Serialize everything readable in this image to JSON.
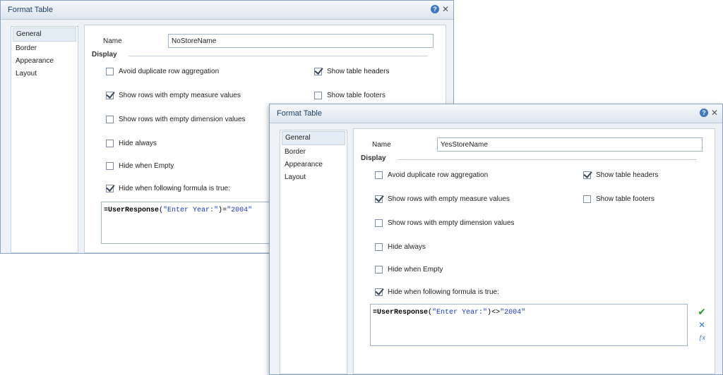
{
  "dialog1": {
    "title": "Format Table",
    "nav": [
      "General",
      "Border",
      "Appearance",
      "Layout"
    ],
    "name_label": "Name",
    "name_value": "NoStoreName",
    "display_label": "Display",
    "options_left": [
      {
        "label": "Avoid duplicate row aggregation",
        "checked": false
      },
      {
        "label": "Show rows with empty measure values",
        "checked": true
      },
      {
        "label": "Show rows with empty dimension values",
        "checked": false
      },
      {
        "label": "Hide always",
        "checked": false
      },
      {
        "label": "Hide when Empty",
        "checked": false
      },
      {
        "label": "Hide when following formula is true:",
        "checked": true
      }
    ],
    "options_right": [
      {
        "label": "Show table headers",
        "checked": true
      },
      {
        "label": "Show table footers",
        "checked": false
      }
    ],
    "formula": {
      "prefix": "=UserResponse",
      "open": "(",
      "arg": "\"Enter Year:\"",
      "close": ")",
      "op": "=",
      "value": "\"2004\""
    }
  },
  "dialog2": {
    "title": "Format Table",
    "nav": [
      "General",
      "Border",
      "Appearance",
      "Layout"
    ],
    "name_label": "Name",
    "name_value": "YesStoreName",
    "display_label": "Display",
    "options_left": [
      {
        "label": "Avoid duplicate row aggregation",
        "checked": false
      },
      {
        "label": "Show rows with empty measure values",
        "checked": true
      },
      {
        "label": "Show rows with empty dimension values",
        "checked": false
      },
      {
        "label": "Hide always",
        "checked": false
      },
      {
        "label": "Hide when Empty",
        "checked": false
      },
      {
        "label": "Hide when following formula is true:",
        "checked": true
      }
    ],
    "options_right": [
      {
        "label": "Show table headers",
        "checked": true
      },
      {
        "label": "Show table footers",
        "checked": false
      }
    ],
    "formula": {
      "prefix": "=UserResponse",
      "open": "(",
      "arg": "\"Enter Year:\"",
      "close": ")",
      "op": "<>",
      "value": "\"2004\""
    }
  },
  "colors": {
    "title_text": "#1b3f6b",
    "accent": "#3c79c0",
    "ok": "#2b9a2b",
    "string": "#1a36c7"
  },
  "icons": {
    "help": "help-icon",
    "close": "close-icon",
    "validate": "check-icon",
    "clear": "x-icon",
    "formula_editor": "fx-icon"
  }
}
